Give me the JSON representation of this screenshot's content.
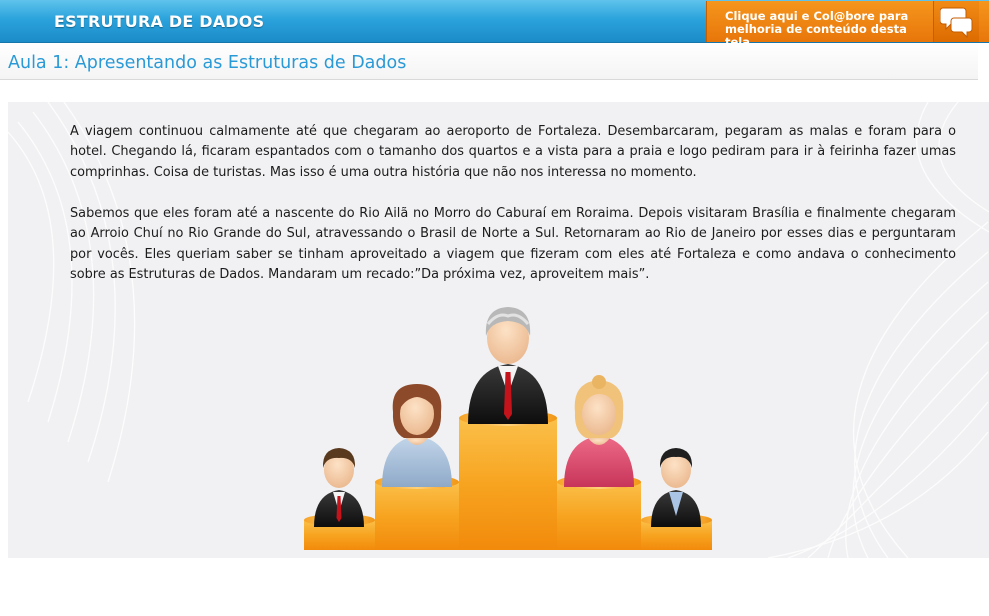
{
  "header": {
    "course_title": "ESTRUTURA DE DADOS",
    "collab_line1": "Clique aqui e Col@bore para",
    "collab_line2": "melhoria de conteúdo desta tela",
    "collab_icon": "chat-bubbles-icon"
  },
  "lesson": {
    "title": "Aula 1: Apresentando as Estruturas de Dados"
  },
  "content": {
    "paragraph_1": "A viagem continuou calmamente até que chegaram ao aeroporto de Fortaleza. Desembarcaram, pegaram as malas e foram para o hotel. Chegando lá, ficaram espantados com o tamanho dos quartos e a vista para a praia e logo pediram para ir à feirinha fazer umas comprinhas. Coisa de turistas. Mas isso é uma outra história que não nos interessa no momento.",
    "paragraph_2": "Sabemos que eles foram até a nascente do Rio Ailã no Morro  do Caburaí em Roraima. Depois visitaram Brasília e finalmente chegaram ao Arroio Chuí no Rio Grande do Sul, atravessando o Brasil de Norte a Sul. Retornaram ao Rio de Janeiro por esses dias e perguntaram por vocês. Eles queriam saber se tinham aproveitado a viagem que fizeram com eles até Fortaleza e como andava o conhecimento sobre as Estruturas de Dados. Mandaram um recado:”Da próxima vez, aproveitem mais”."
  },
  "illustration": {
    "name": "family-podium-illustration",
    "figures": [
      "boy",
      "woman",
      "grandfather",
      "girl",
      "man"
    ]
  },
  "colors": {
    "header_blue": "#2ba3dc",
    "collab_orange": "#e8760a",
    "title_blue": "#2a9ad7",
    "podium_orange": "#f7a420"
  }
}
